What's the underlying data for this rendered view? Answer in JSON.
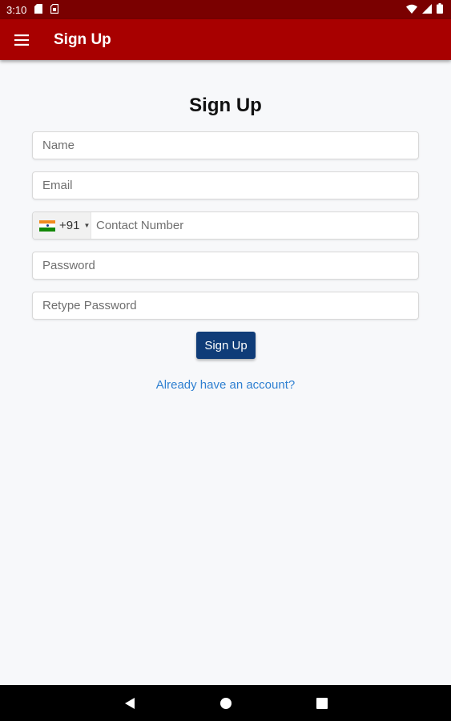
{
  "status_bar": {
    "time": "3:10",
    "icons": [
      "sd-card-icon",
      "sim-card-icon",
      "wifi-icon",
      "signal-icon",
      "battery-icon"
    ]
  },
  "app_bar": {
    "title": "Sign Up",
    "menu_icon": "hamburger-menu-icon",
    "background_color": "#a80000"
  },
  "form": {
    "heading": "Sign Up",
    "name_placeholder": "Name",
    "email_placeholder": "Email",
    "phone": {
      "country_flag": "india-flag-icon",
      "country_code": "+91",
      "placeholder": "Contact Number"
    },
    "password_placeholder": "Password",
    "retype_password_placeholder": "Retype Password",
    "submit_label": "Sign Up",
    "submit_color": "#0f3c78",
    "login_link": "Already have an account?",
    "link_color": "#2f80d1"
  },
  "nav_bar": {
    "icons": [
      "back-icon",
      "home-icon",
      "recents-icon"
    ]
  }
}
